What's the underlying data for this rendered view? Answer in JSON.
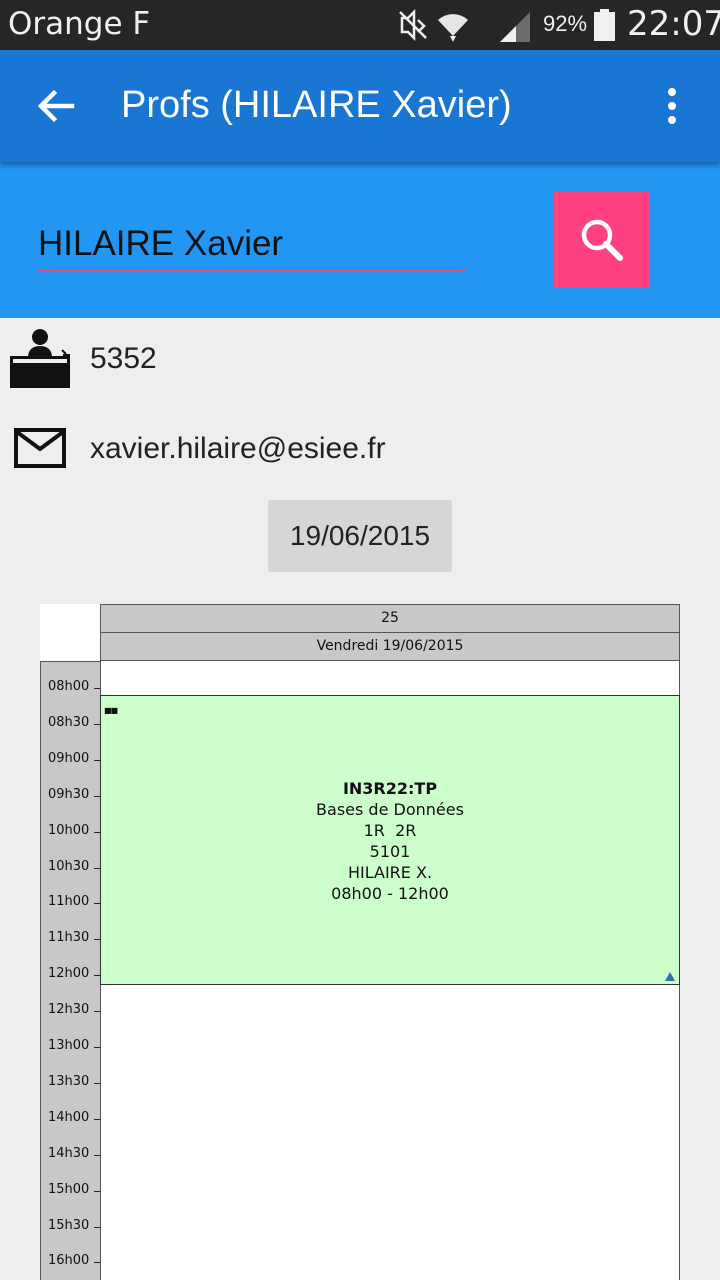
{
  "status_bar": {
    "carrier": "Orange F",
    "battery_percent": "92%",
    "time": "22:07",
    "icons": [
      "mute-icon",
      "wifi-icon",
      "signal-icon",
      "battery-icon"
    ]
  },
  "app_bar": {
    "title": "Profs (HILAIRE Xavier)",
    "icons": [
      "back-arrow-icon",
      "overflow-menu-icon"
    ]
  },
  "search": {
    "value": "HILAIRE Xavier",
    "button_icon": "search-icon"
  },
  "teacher": {
    "office": "5352",
    "office_icon": "desk-person-icon",
    "email": "xavier.hilaire@esiee.fr",
    "email_icon": "mail-icon"
  },
  "date_button": {
    "label": "19/06/2015"
  },
  "timetable": {
    "week_number": "25",
    "day_label": "Vendredi 19/06/2015",
    "hours": [
      "08h00",
      "08h30",
      "09h00",
      "09h30",
      "10h00",
      "10h30",
      "11h00",
      "11h30",
      "12h00",
      "12h30",
      "13h00",
      "13h30",
      "14h00",
      "14h30",
      "15h00",
      "15h30",
      "16h00"
    ],
    "event": {
      "code": "IN3R22:TP",
      "subject": "Bases de Données",
      "groups": "1R  2R",
      "room": "5101",
      "teacher": "HILAIRE X.",
      "time_range": "08h00 - 12h00",
      "color": "#ccffcc"
    }
  },
  "colors": {
    "app_bar": "#1976d2",
    "search_band": "#2196f3",
    "accent": "#ff4081",
    "underline": "#e84a7a"
  }
}
